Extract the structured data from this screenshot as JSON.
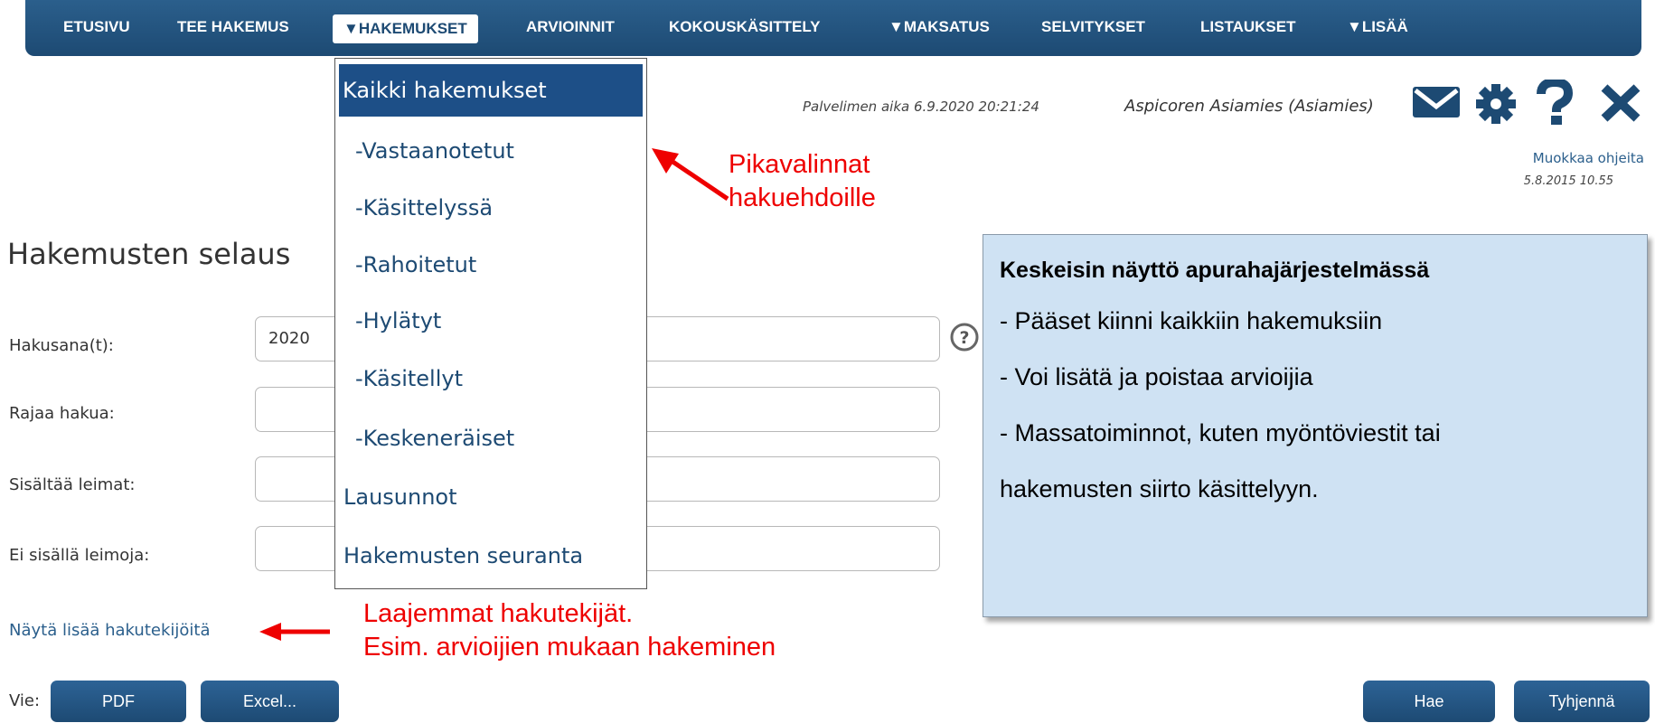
{
  "nav": {
    "items": [
      {
        "label": "ETUSIVU"
      },
      {
        "label": "TEE HAKEMUS"
      },
      {
        "label": "▼HAKEMUKSET"
      },
      {
        "label": "ARVIOINNIT"
      },
      {
        "label": "KOKOUSKÄSITTELY"
      },
      {
        "label": "▼MAKSATUS"
      },
      {
        "label": "SELVITYKSET"
      },
      {
        "label": "LISTAUKSET"
      },
      {
        "label": "▼LISÄÄ"
      }
    ],
    "active_item": "▼HAKEMUKSET"
  },
  "header": {
    "server_time": "Palvelimen aika 6.9.2020 20:21:24",
    "user": "Aspicoren Asiamies (Asiamies)",
    "icons": [
      "mail-icon",
      "gear-icon",
      "help-icon",
      "close-icon"
    ],
    "help_link": "Muokkaa ohjeita",
    "help_date": "5.8.2015 10.55"
  },
  "dropdown": {
    "items": [
      {
        "label": "Kaikki hakemukset",
        "active": true
      },
      {
        "label": "-Vastaanotetut"
      },
      {
        "label": "-Käsittelyssä"
      },
      {
        "label": "-Rahoitetut"
      },
      {
        "label": "-Hylätyt"
      },
      {
        "label": "-Käsitellyt"
      },
      {
        "label": "-Keskeneräiset"
      },
      {
        "label": "Lausunnot"
      },
      {
        "label": "Hakemusten seuranta"
      }
    ]
  },
  "page": {
    "title": "Hakemusten selaus",
    "fields": [
      {
        "label": "Hakusana(t):",
        "value": "2020"
      },
      {
        "label": "Rajaa hakua:",
        "value": ""
      },
      {
        "label": "Sisältää leimat:",
        "value": ""
      },
      {
        "label": "Ei sisällä leimoja:",
        "value": ""
      }
    ],
    "more_link": "Näytä lisää hakutekijöitä",
    "export_label": "Vie:",
    "buttons": {
      "pdf": "PDF",
      "excel": "Excel...",
      "search": "Hae",
      "clear": "Tyhjennä"
    }
  },
  "annotations": {
    "quick_1": "Pikavalinnat",
    "quick_2": "hakuehdoille",
    "more_1": "Laajemmat hakutekijät.",
    "more_2": "Esim. arvioijien mukaan hakeminen",
    "callout_title": "Keskeisin näyttö apurahajärjestelmässä",
    "callout_lines": [
      "- Pääset kiinni kaikkiin hakemuksiin",
      "- Voi lisätä ja poistaa arvioijia",
      "- Massatoiminnot, kuten myöntöviestit tai",
      "hakemusten siirto käsittelyyn."
    ]
  },
  "colors": {
    "nav_bg": "#1d4a73",
    "accent": "#2b5f8c",
    "annotation": "#ee0000",
    "callout_bg": "#cfe2f3"
  }
}
